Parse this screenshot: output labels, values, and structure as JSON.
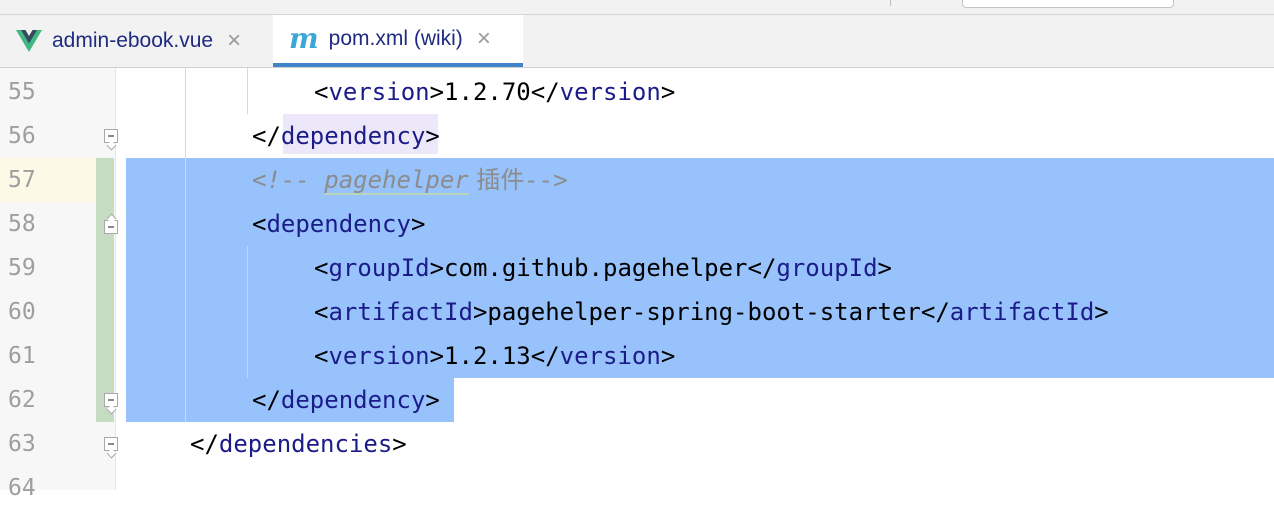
{
  "tabs": [
    {
      "label": "admin-ebook.vue",
      "icon": "vue-icon",
      "active": false
    },
    {
      "label": "pom.xml (wiki)",
      "icon": "maven-icon",
      "active": true
    }
  ],
  "colors": {
    "selection": "#97c2fc",
    "tag": "#1b1c88",
    "comment": "#8c8c8c",
    "tab_underline": "#4083c9",
    "vcs_change": "#c5dcc3"
  },
  "editor": {
    "lines": [
      {
        "number": "55",
        "parts": [
          "<",
          "version",
          ">1.2.70</",
          "version",
          ">"
        ]
      },
      {
        "number": "56",
        "parts": [
          "</",
          "dependency",
          ">"
        ]
      },
      {
        "number": "57",
        "comment_open": "<!-- ",
        "comment_word": "pagehelper",
        "comment_cjk": " 插件",
        "comment_close": "-->"
      },
      {
        "number": "58",
        "parts": [
          "<",
          "dependency",
          ">"
        ]
      },
      {
        "number": "59",
        "parts": [
          "<",
          "groupId",
          ">com.github.pagehelper</",
          "groupId",
          ">"
        ]
      },
      {
        "number": "60",
        "parts": [
          "<",
          "artifactId",
          ">pagehelper-spring-boot-starter</",
          "artifactId",
          ">"
        ]
      },
      {
        "number": "61",
        "parts": [
          "<",
          "version",
          ">1.2.13</",
          "version",
          ">"
        ]
      },
      {
        "number": "62",
        "parts": [
          "</",
          "dependency",
          ">"
        ]
      },
      {
        "number": "63",
        "parts": [
          "</",
          "dependencies",
          ">"
        ]
      },
      {
        "number": "64"
      }
    ]
  }
}
